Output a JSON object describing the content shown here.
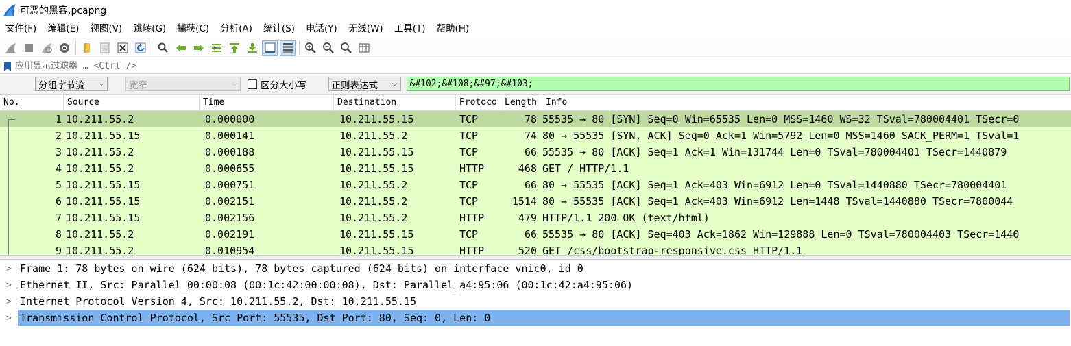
{
  "window": {
    "title": "可恶的黑客.pcapng"
  },
  "menu": [
    {
      "label": "文件(F)"
    },
    {
      "label": "编辑(E)"
    },
    {
      "label": "视图(V)"
    },
    {
      "label": "跳转(G)"
    },
    {
      "label": "捕获(C)"
    },
    {
      "label": "分析(A)"
    },
    {
      "label": "统计(S)"
    },
    {
      "label": "电话(Y)"
    },
    {
      "label": "无线(W)"
    },
    {
      "label": "工具(T)"
    },
    {
      "label": "帮助(H)"
    }
  ],
  "display_filter": {
    "placeholder": "应用显示过滤器 … <Ctrl-/>"
  },
  "find_bar": {
    "search_in": "分组字节流",
    "char_width": "宽窄",
    "case_sensitive_label": "区分大小写",
    "search_type": "正则表达式",
    "search_value": "&#102;&#108;&#97;&#103;"
  },
  "columns": {
    "no": "No.",
    "source": "Source",
    "time": "Time",
    "destination": "Destination",
    "protocol": "Protoco",
    "length": "Length",
    "info": "Info"
  },
  "packets": [
    {
      "no": "1",
      "source": "10.211.55.2",
      "time": "0.000000",
      "destination": "10.211.55.15",
      "protocol": "TCP",
      "length": "78",
      "info": "55535 → 80 [SYN] Seq=0 Win=65535 Len=0 MSS=1460 WS=32 TSval=780004401 TSecr=0"
    },
    {
      "no": "2",
      "source": "10.211.55.15",
      "time": "0.000141",
      "destination": "10.211.55.2",
      "protocol": "TCP",
      "length": "74",
      "info": "80 → 55535 [SYN, ACK] Seq=0 Ack=1 Win=5792 Len=0 MSS=1460 SACK_PERM=1 TSval=1"
    },
    {
      "no": "3",
      "source": "10.211.55.2",
      "time": "0.000188",
      "destination": "10.211.55.15",
      "protocol": "TCP",
      "length": "66",
      "info": "55535 → 80 [ACK] Seq=1 Ack=1 Win=131744 Len=0 TSval=780004401 TSecr=1440879"
    },
    {
      "no": "4",
      "source": "10.211.55.2",
      "time": "0.000655",
      "destination": "10.211.55.15",
      "protocol": "HTTP",
      "length": "468",
      "info": "GET / HTTP/1.1"
    },
    {
      "no": "5",
      "source": "10.211.55.15",
      "time": "0.000751",
      "destination": "10.211.55.2",
      "protocol": "TCP",
      "length": "66",
      "info": "80 → 55535 [ACK] Seq=1 Ack=403 Win=6912 Len=0 TSval=1440880 TSecr=780004401"
    },
    {
      "no": "6",
      "source": "10.211.55.15",
      "time": "0.002151",
      "destination": "10.211.55.2",
      "protocol": "TCP",
      "length": "1514",
      "info": "80 → 55535 [ACK] Seq=1 Ack=403 Win=6912 Len=1448 TSval=1440880 TSecr=7800044"
    },
    {
      "no": "7",
      "source": "10.211.55.15",
      "time": "0.002156",
      "destination": "10.211.55.2",
      "protocol": "HTTP",
      "length": "479",
      "info": "HTTP/1.1 200 OK  (text/html)"
    },
    {
      "no": "8",
      "source": "10.211.55.2",
      "time": "0.002191",
      "destination": "10.211.55.15",
      "protocol": "TCP",
      "length": "66",
      "info": "55535 → 80 [ACK] Seq=403 Ack=1862 Win=129888 Len=0 TSval=780004403 TSecr=1440"
    },
    {
      "no": "9",
      "source": "10.211.55.2",
      "time": "0.010954",
      "destination": "10.211.55.15",
      "protocol": "HTTP",
      "length": "520",
      "info": "GET /css/bootstrap-responsive.css HTTP/1.1"
    }
  ],
  "details": [
    {
      "text": "Frame 1: 78 bytes on wire (624 bits), 78 bytes captured (624 bits) on interface vnic0, id 0"
    },
    {
      "text": "Ethernet II, Src: Parallel_00:00:08 (00:1c:42:00:00:08), Dst: Parallel_a4:95:06 (00:1c:42:a4:95:06)"
    },
    {
      "text": "Internet Protocol Version 4, Src: 10.211.55.2, Dst: 10.211.55.15"
    },
    {
      "text": "Transmission Control Protocol, Src Port: 55535, Dst Port: 80, Seq: 0, Len: 0"
    }
  ],
  "colors": {
    "packet_row_bg": "#e4ffc7",
    "selected_packet_bg": "#bfd9a2",
    "selected_detail_bg": "#7fb3f0",
    "search_field_bg": "#afffaf"
  }
}
